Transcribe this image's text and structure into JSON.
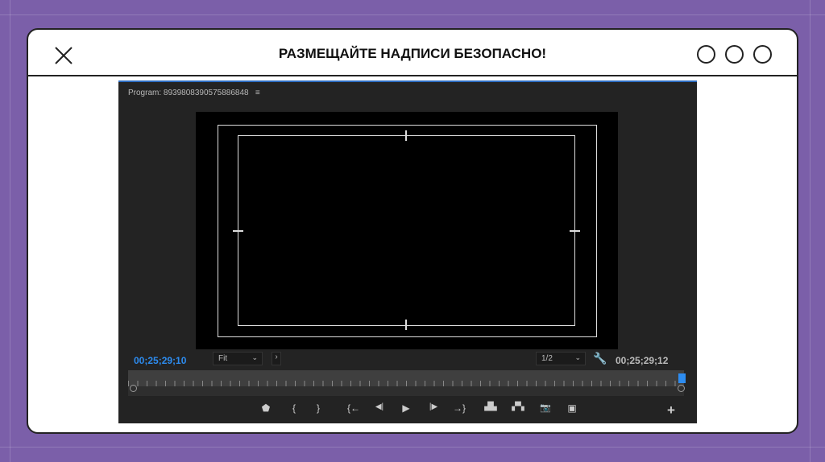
{
  "window": {
    "title": "РАЗМЕЩАЙТЕ НАДПИСИ БЕЗОПАСНО!"
  },
  "panel": {
    "title": "Program: 8939808390575886848",
    "menu_icon": "≡"
  },
  "timecode_current": "00;25;29;10",
  "timecode_end": "00;25;29;12",
  "zoom_select": "Fit",
  "resolution_select": "1/2",
  "controls": [
    {
      "name": "add-marker",
      "glyph": "⬟"
    },
    {
      "name": "mark-in",
      "glyph": "{"
    },
    {
      "name": "mark-out",
      "glyph": "}"
    },
    {
      "name": "go-to-in",
      "glyph": "{←"
    },
    {
      "name": "step-back",
      "glyph": "◀|"
    },
    {
      "name": "play",
      "glyph": "▶"
    },
    {
      "name": "step-forward",
      "glyph": "|▶"
    },
    {
      "name": "go-to-out",
      "glyph": "→}"
    },
    {
      "name": "lift",
      "glyph": "▟▙"
    },
    {
      "name": "extract",
      "glyph": "▞▚"
    },
    {
      "name": "export-frame",
      "glyph": "📷"
    },
    {
      "name": "compare",
      "glyph": "▣"
    }
  ],
  "add_button": "+",
  "colors": {
    "accent": "#2d8cf0",
    "background": "#7b5fa9"
  }
}
